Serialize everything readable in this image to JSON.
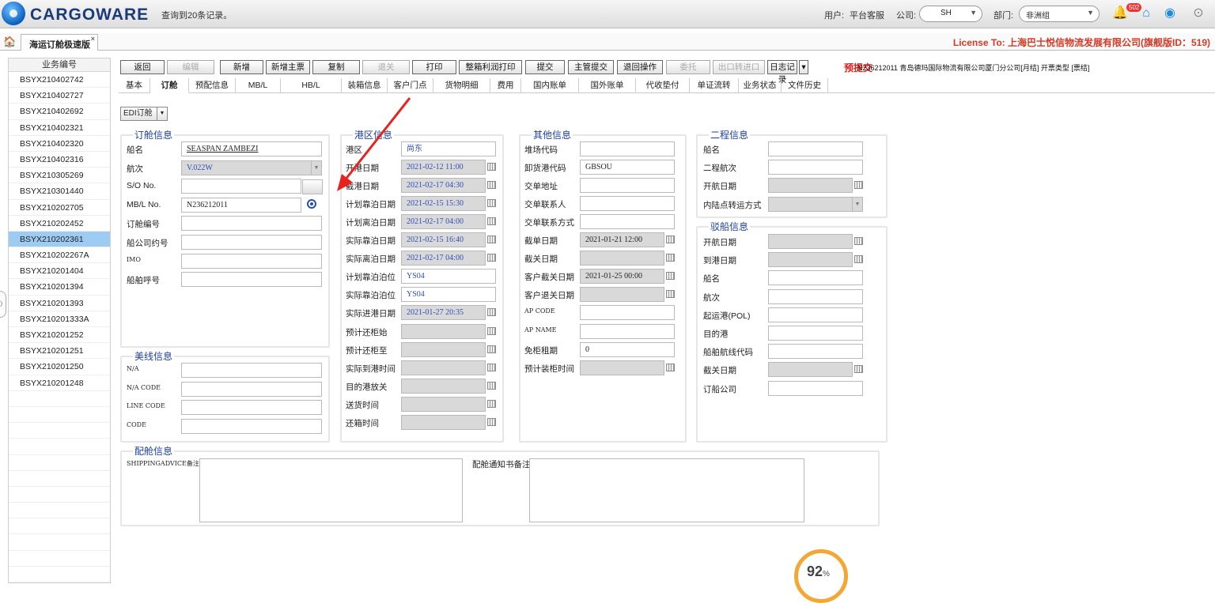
{
  "header": {
    "logo_text": "CARGOWARE",
    "query_info": "查询到20条记录。",
    "user_label": "用户:",
    "user_value": "平台客服",
    "company_label": "公司:",
    "company_value": "SH",
    "dept_label": "部门:",
    "dept_value": "非洲组",
    "notification_count": "502"
  },
  "tabs": {
    "main_tab": "海运订舱极速版",
    "close": "×",
    "license": "License To: 上海巴士悦信物流发展有限公司(旗舰版ID：519)"
  },
  "sidebar": {
    "header": "业务编号",
    "items": [
      "BSYX210402742",
      "BSYX210402727",
      "BSYX210402692",
      "BSYX210402321",
      "BSYX210402320",
      "BSYX210402316",
      "BSYX210305269",
      "BSYX210301440",
      "BSYX210202705",
      "BSYX210202452",
      "BSYX210202361",
      "BSYX210202267A",
      "BSYX210201404",
      "BSYX210201394",
      "BSYX210201393",
      "BSYX210201333A",
      "BSYX210201252",
      "BSYX210201251",
      "BSYX210201250",
      "BSYX210201248"
    ],
    "selected_index": 10
  },
  "toolbar": {
    "buttons": [
      {
        "label": "返回",
        "disabled": false
      },
      {
        "label": "编辑",
        "disabled": true
      },
      {
        "label": "新增",
        "disabled": false
      },
      {
        "label": "新增主票",
        "disabled": false
      },
      {
        "label": "复制",
        "disabled": false
      },
      {
        "label": "退关",
        "disabled": true
      },
      {
        "label": "打印",
        "disabled": false
      },
      {
        "label": "整箱利润打印",
        "disabled": false
      },
      {
        "label": "提交",
        "disabled": false
      },
      {
        "label": "主管提交",
        "disabled": false
      },
      {
        "label": "退回操作",
        "disabled": false
      },
      {
        "label": "委托",
        "disabled": true
      },
      {
        "label": "出口转进口",
        "disabled": true
      },
      {
        "label": "日志记录",
        "disabled": false
      }
    ],
    "status": "预提交",
    "info": "N236212011  青岛德玛国际物流有限公司厦门分公司[月结]  开票类型 [票结]"
  },
  "subtabs": [
    "基本",
    "订舱",
    "预配信息",
    "MB/L",
    "HB/L",
    "装箱信息",
    "客户门点",
    "货物明细",
    "费用",
    "国内账单",
    "国外账单",
    "代收垫付",
    "单证流转",
    "业务状态",
    "文件历史"
  ],
  "edi_button": "EDI订舱",
  "booking": {
    "title": "订舱信息",
    "fields": [
      {
        "label": "船名",
        "value": "SEASPAN ZAMBEZI"
      },
      {
        "label": "航次",
        "value": "V.022W"
      },
      {
        "label": "S/O No.",
        "value": ""
      },
      {
        "label": "MB/L No.",
        "value": "N236212011"
      },
      {
        "label": "订舱编号",
        "value": ""
      },
      {
        "label": "船公司约号",
        "value": ""
      },
      {
        "label": "IMO",
        "value": ""
      },
      {
        "label": "船舶呼号",
        "value": ""
      }
    ]
  },
  "us_line": {
    "title": "美线信息",
    "fields": [
      {
        "label": "N/A",
        "value": ""
      },
      {
        "label": "N/A CODE",
        "value": ""
      },
      {
        "label": "LINE CODE",
        "value": ""
      },
      {
        "label": "CODE",
        "value": ""
      }
    ]
  },
  "port": {
    "title": "港区信息",
    "fields": [
      {
        "label": "港区",
        "value": "尚东"
      },
      {
        "label": "开港日期",
        "value": "2021-02-12 11:00"
      },
      {
        "label": "截港日期",
        "value": "2021-02-17 04:30"
      },
      {
        "label": "计划靠泊日期",
        "value": "2021-02-15 15:30"
      },
      {
        "label": "计划离泊日期",
        "value": "2021-02-17 04:00"
      },
      {
        "label": "实际靠泊日期",
        "value": "2021-02-15 16:40"
      },
      {
        "label": "实际离泊日期",
        "value": "2021-02-17 04:00"
      },
      {
        "label": "计划靠泊泊位",
        "value": "YS04"
      },
      {
        "label": "实际靠泊泊位",
        "value": "YS04"
      },
      {
        "label": "实际进港日期",
        "value": "2021-01-27 20:35"
      },
      {
        "label": "预计还柜始",
        "value": ""
      },
      {
        "label": "预计还柜至",
        "value": ""
      },
      {
        "label": "实际到港时间",
        "value": ""
      },
      {
        "label": "目的港放关",
        "value": ""
      },
      {
        "label": "送货时间",
        "value": ""
      },
      {
        "label": "还箱时间",
        "value": ""
      }
    ]
  },
  "other": {
    "title": "其他信息",
    "fields": [
      {
        "label": "堆场代码",
        "value": ""
      },
      {
        "label": "卸货港代码",
        "value": "GBSOU"
      },
      {
        "label": "交单地址",
        "value": ""
      },
      {
        "label": "交单联系人",
        "value": ""
      },
      {
        "label": "交单联系方式",
        "value": ""
      },
      {
        "label": "截单日期",
        "value": "2021-01-21 12:00"
      },
      {
        "label": "截关日期",
        "value": ""
      },
      {
        "label": "客户截关日期",
        "value": "2021-01-25 00:00"
      },
      {
        "label": "客户退关日期",
        "value": ""
      },
      {
        "label": "AP CODE",
        "value": ""
      },
      {
        "label": "AP NAME",
        "value": ""
      },
      {
        "label": "免柜租期",
        "value": "0"
      },
      {
        "label": "预计装柜时间",
        "value": ""
      }
    ]
  },
  "second": {
    "title": "二程信息",
    "fields": [
      {
        "label": "船名",
        "value": ""
      },
      {
        "label": "二程航次",
        "value": ""
      },
      {
        "label": "开航日期",
        "value": ""
      },
      {
        "label": "内陆点转运方式",
        "value": ""
      }
    ]
  },
  "barge": {
    "title": "驳船信息",
    "fields": [
      {
        "label": "开航日期",
        "value": ""
      },
      {
        "label": "到港日期",
        "value": ""
      },
      {
        "label": "船名",
        "value": ""
      },
      {
        "label": "航次",
        "value": ""
      },
      {
        "label": "起运港(POL)",
        "value": ""
      },
      {
        "label": "目的港",
        "value": ""
      },
      {
        "label": "船舶航线代码",
        "value": ""
      },
      {
        "label": "截关日期",
        "value": ""
      },
      {
        "label": "订船公司",
        "value": ""
      }
    ]
  },
  "stowage": {
    "title": "配舱信息",
    "remark1_label": "SHIPPINGADVICE备注",
    "remark2_label": "配舱通知书备注"
  },
  "progress": {
    "value": "92",
    "unit": "%"
  }
}
